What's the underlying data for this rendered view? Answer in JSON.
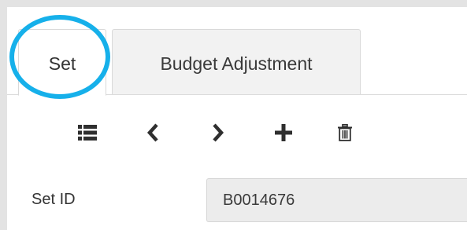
{
  "tabs": [
    {
      "label": "Set",
      "active": true
    },
    {
      "label": "Budget Adjustment",
      "active": false
    }
  ],
  "toolbar": {
    "icons": [
      "list-icon",
      "chevron-left-icon",
      "chevron-right-icon",
      "plus-icon",
      "trash-icon"
    ],
    "icon_color": "#2f2f2f"
  },
  "form": {
    "set_id_label": "Set ID",
    "set_id_value": "B0014676"
  },
  "colors": {
    "highlight": "#16b0ea",
    "input_bg": "#ececec",
    "inactive_tab_bg": "#f2f2f2"
  }
}
